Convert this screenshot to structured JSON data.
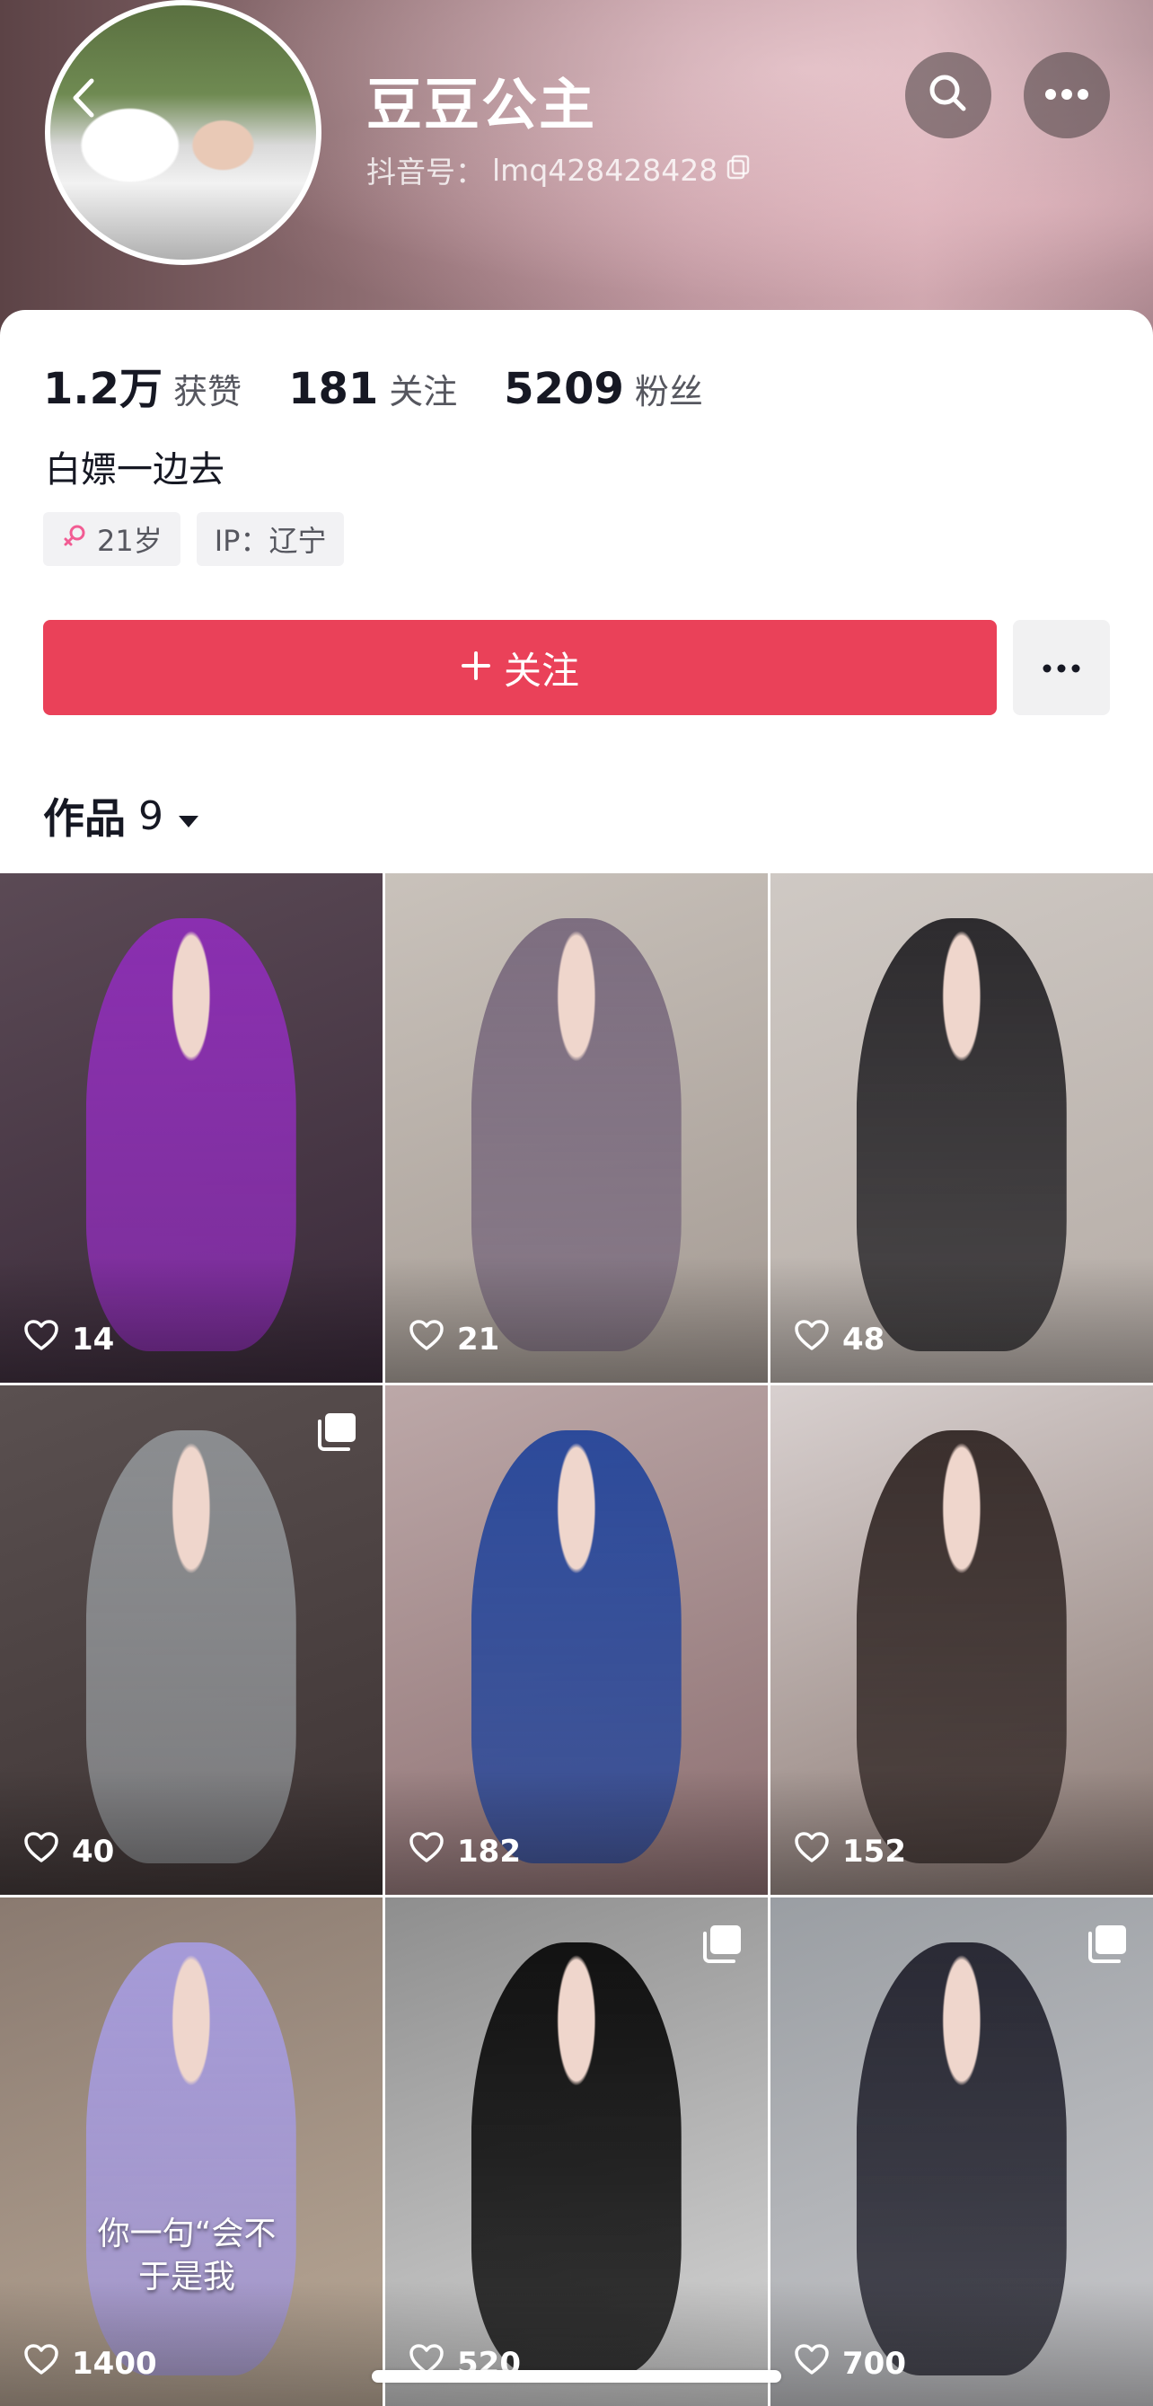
{
  "header": {
    "name": "豆豆公主",
    "douyin_id_label": "抖音号：",
    "douyin_id": "lmq428428428",
    "icons": {
      "back": "chevron-left-icon",
      "search": "search-icon",
      "more": "more-horizontal-icon",
      "copy": "copy-icon"
    }
  },
  "stats": [
    {
      "value": "1.2万",
      "label": "获赞"
    },
    {
      "value": "181",
      "label": "关注"
    },
    {
      "value": "5209",
      "label": "粉丝"
    }
  ],
  "bio": "白嫖一边去",
  "tags": {
    "age": "21岁",
    "ip": "IP：辽宁"
  },
  "actions": {
    "follow_label": "关注",
    "follow_color": "#ea4159"
  },
  "works": {
    "label": "作品",
    "count": "9"
  },
  "videos": [
    {
      "likes": "14",
      "multi": false,
      "palette": [
        "#5b4a55",
        "#3a2a3a",
        "#8a2fb0"
      ]
    },
    {
      "likes": "21",
      "multi": false,
      "palette": [
        "#c9c2bb",
        "#a49a93",
        "#7d6e80"
      ]
    },
    {
      "likes": "48",
      "multi": false,
      "palette": [
        "#cfc9c4",
        "#b5aca6",
        "#2d2b2e"
      ]
    },
    {
      "likes": "40",
      "multi": true,
      "palette": [
        "#5a5050",
        "#3e3434",
        "#8b8d90"
      ]
    },
    {
      "likes": "182",
      "multi": false,
      "palette": [
        "#bca8a8",
        "#8c6e70",
        "#2c4a9a"
      ]
    },
    {
      "likes": "152",
      "multi": false,
      "palette": [
        "#d8d0cf",
        "#8a7872",
        "#3a2f2d"
      ]
    },
    {
      "likes": "1400",
      "multi": false,
      "overlay_line1": "你一句“会不",
      "overlay_line2": "于是我",
      "palette": [
        "#8a7a70",
        "#b9a896",
        "#a59ad8"
      ]
    },
    {
      "likes": "520",
      "multi": true,
      "palette": [
        "#8e8e8e",
        "#d7d7d7",
        "#121212"
      ]
    },
    {
      "likes": "700",
      "multi": true,
      "palette": [
        "#9a9ea3",
        "#c9c9cc",
        "#2a2a35"
      ]
    }
  ]
}
